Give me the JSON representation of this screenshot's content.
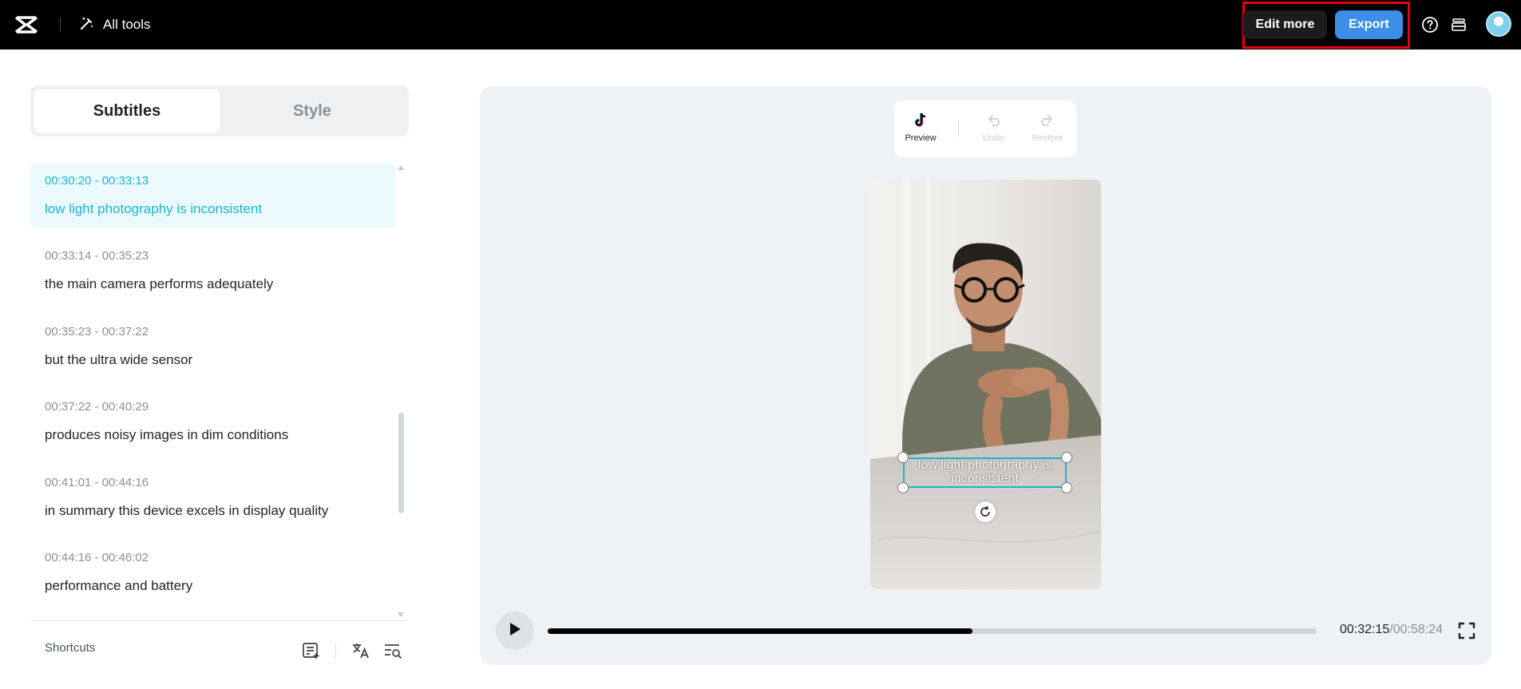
{
  "header": {
    "all_tools_label": "All tools",
    "edit_more_label": "Edit more",
    "export_label": "Export",
    "icons": [
      "capcut-logo-icon",
      "magic-wand-icon",
      "help-icon",
      "layers-icon",
      "avatar"
    ]
  },
  "sidebar": {
    "tabs": [
      {
        "label": "Subtitles",
        "active": true
      },
      {
        "label": "Style",
        "active": false
      }
    ],
    "subtitles": [
      {
        "start": "00:30:20",
        "end": "00:33:13",
        "time": "00:30:20  -  00:33:13",
        "text": "low light photography is inconsistent",
        "active": true
      },
      {
        "start": "00:33:14",
        "end": "00:35:23",
        "time": "00:33:14   -  00:35:23",
        "text": "the main camera performs adequately",
        "active": false
      },
      {
        "start": "00:35:23",
        "end": "00:37:22",
        "time": "00:35:23  -  00:37:22",
        "text": "but the ultra wide sensor",
        "active": false
      },
      {
        "start": "00:37:22",
        "end": "00:40:29",
        "time": "00:37:22   -  00:40:29",
        "text": "produces noisy images in dim conditions",
        "active": false
      },
      {
        "start": "00:41:01",
        "end": "00:44:16",
        "time": "00:41:01    -  00:44:16",
        "text": "in summary this device excels in display quality",
        "active": false
      },
      {
        "start": "00:44:16",
        "end": "00:46:02",
        "time": "00:44:16   -  00:46:02",
        "text": "performance and battery",
        "active": false
      }
    ],
    "shortcuts_label": "Shortcuts"
  },
  "preview": {
    "toolbar": {
      "preview_label": "Preview",
      "undo_label": "Undo",
      "restore_label": "Restore"
    },
    "caption_text": "low light photography is inconsistent",
    "playback": {
      "current_time": "00:32:15",
      "total_time": "/00:58:24",
      "progress_fraction": 0.552
    }
  },
  "colors": {
    "accent_cyan": "#18b6cf",
    "export_blue": "#3c8ee8",
    "highlight_red": "#e5000f"
  }
}
